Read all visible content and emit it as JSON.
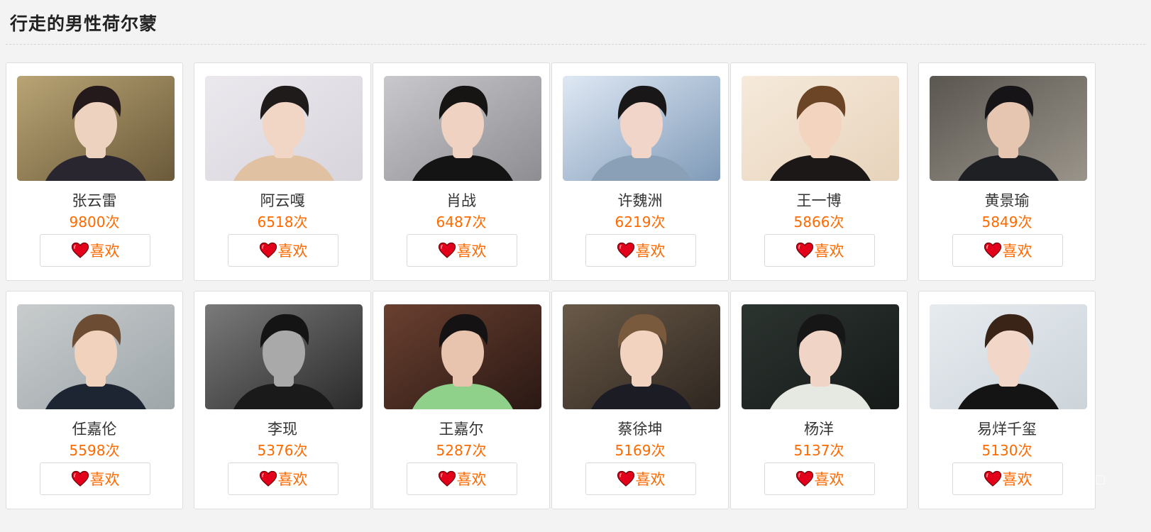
{
  "page": {
    "title": "行走的男性荷尔蒙"
  },
  "icons": {
    "like": "heart-icon"
  },
  "colors": {
    "accent": "#ff6a00",
    "heart": "#e2001a"
  },
  "cards": [
    {
      "name": "张云雷",
      "count": "9800次",
      "like_label": "喜欢",
      "bg": [
        "#b8a474",
        "#6b5a3a"
      ],
      "shirt": "#2a2630",
      "hair": "#241a1c",
      "skin": "#eed2c0"
    },
    {
      "name": "阿云嘎",
      "count": "6518次",
      "like_label": "喜欢",
      "bg": [
        "#ebe8ee",
        "#d8d4dc"
      ],
      "shirt": "#e0c2a2",
      "hair": "#1f1b1b",
      "skin": "#f1d6c6"
    },
    {
      "name": "肖战",
      "count": "6487次",
      "like_label": "喜欢",
      "bg": [
        "#c9c8cc",
        "#8d8d92"
      ],
      "shirt": "#141414",
      "hair": "#171414",
      "skin": "#f0d2c2"
    },
    {
      "name": "许魏洲",
      "count": "6219次",
      "like_label": "喜欢",
      "bg": [
        "#dfe8f4",
        "#7f9ab8"
      ],
      "shirt": "#8aa0b6",
      "hair": "#1a1718",
      "skin": "#f1d5c8"
    },
    {
      "name": "王一博",
      "count": "5866次",
      "like_label": "喜欢",
      "bg": [
        "#f6eadb",
        "#e7d3bb"
      ],
      "shirt": "#1b1817",
      "hair": "#6b4526",
      "skin": "#f2d4bf"
    },
    {
      "name": "黄景瑜",
      "count": "5849次",
      "like_label": "喜欢",
      "bg": [
        "#5a5650",
        "#9a948a"
      ],
      "shirt": "#1e2024",
      "hair": "#161416",
      "skin": "#e6c6b0"
    },
    {
      "name": "任嘉伦",
      "count": "5598次",
      "like_label": "喜欢",
      "bg": [
        "#c8cccd",
        "#9ea6aa"
      ],
      "shirt": "#1d2432",
      "hair": "#6c4d33",
      "skin": "#f0d2bd"
    },
    {
      "name": "李现",
      "count": "5376次",
      "like_label": "喜欢",
      "bg": [
        "#7a7a7a",
        "#2a2a2a"
      ],
      "shirt": "#1a1a1a",
      "hair": "#141414",
      "skin": "#a9a9a9"
    },
    {
      "name": "王嘉尔",
      "count": "5287次",
      "like_label": "喜欢",
      "bg": [
        "#6a4030",
        "#2a1814"
      ],
      "shirt": "#8fd08a",
      "hair": "#141212",
      "skin": "#e8c4ae"
    },
    {
      "name": "蔡徐坤",
      "count": "5169次",
      "like_label": "喜欢",
      "bg": [
        "#6a5a48",
        "#2e2620"
      ],
      "shirt": "#1c1d24",
      "hair": "#7a5a3c",
      "skin": "#f1d3c0"
    },
    {
      "name": "杨洋",
      "count": "5137次",
      "like_label": "喜欢",
      "bg": [
        "#2c3430",
        "#151a18"
      ],
      "shirt": "#e6e8e2",
      "hair": "#161616",
      "skin": "#f0d4c6"
    },
    {
      "name": "易烊千玺",
      "count": "5130次",
      "like_label": "喜欢",
      "bg": [
        "#e6ebef",
        "#ccd4da"
      ],
      "shirt": "#141414",
      "hair": "#3a2418",
      "skin": "#f2d6c8"
    }
  ]
}
